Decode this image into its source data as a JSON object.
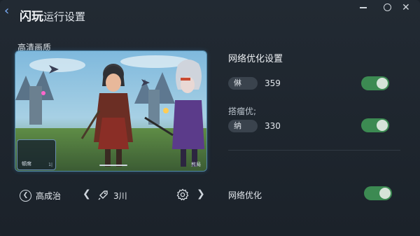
{
  "header": {
    "title_main": "闪玩",
    "title_sub": "运行设置"
  },
  "preview": {
    "label": "高清画质",
    "mini_label": "顿席",
    "mini_num": "1|",
    "corner_label": "煎局"
  },
  "bottom_bar": {
    "quality_label": "高成治",
    "fps_value": "3川"
  },
  "settings": {
    "section_title": "网络优化设置",
    "row1": {
      "pill": "㑣",
      "value": "359",
      "toggle_on": true
    },
    "sub_title": "搭瘤优;",
    "row2": {
      "pill": "纳",
      "value": "330",
      "toggle_on": true
    },
    "net_label": "网络优化",
    "net_toggle_on": true
  },
  "colors": {
    "accent_green": "#3c8a52",
    "frame_border": "#4f86a8",
    "back_blue": "#7fb2ff"
  },
  "icons": [
    "chevron-left-icon",
    "minimize-icon",
    "maximize-icon",
    "close-icon",
    "circle-back-icon",
    "rocket-icon",
    "gear-icon",
    "chevron-right-icon"
  ]
}
